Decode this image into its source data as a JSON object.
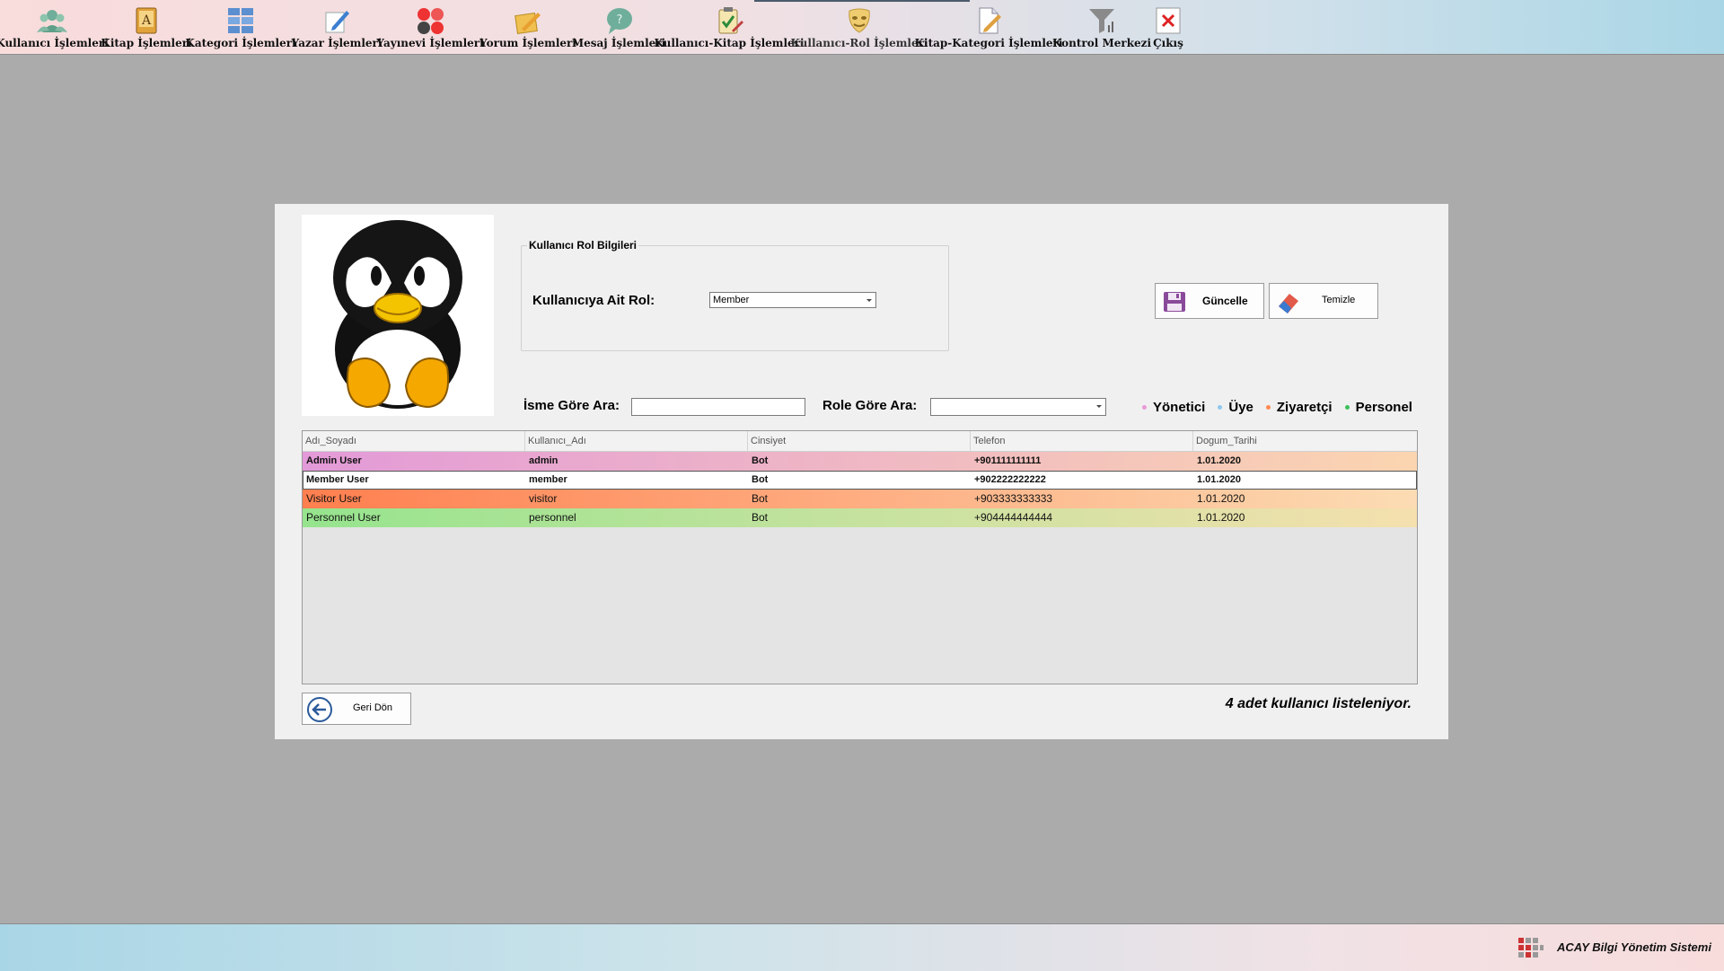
{
  "toolbar": {
    "items": [
      {
        "label": "Kullanıcı İşlemleri",
        "icon": "users-icon"
      },
      {
        "label": "Kitap İşlemleri",
        "icon": "book-icon"
      },
      {
        "label": "Kategori İşlemleri",
        "icon": "category-grid-icon"
      },
      {
        "label": "Yazar İşlemleri",
        "icon": "author-pen-icon"
      },
      {
        "label": "Yayınevi İşlemleri",
        "icon": "publisher-dots-icon"
      },
      {
        "label": "Yorum İşlemleri",
        "icon": "comment-pencil-icon"
      },
      {
        "label": "Mesaj İşlemleri",
        "icon": "message-bubble-icon"
      },
      {
        "label": "Kullanıcı-Kitap İşlemleri",
        "icon": "clipboard-check-icon"
      },
      {
        "label": "Kullanıcı-Rol İşlemleri",
        "icon": "role-mask-icon"
      },
      {
        "label": "Kitap-Kategori İşlemleri",
        "icon": "document-edit-icon"
      },
      {
        "label": "Kontrol Merkezi",
        "icon": "filter-chart-icon"
      },
      {
        "label": "Çıkış",
        "icon": "exit-close-icon"
      }
    ]
  },
  "role_group": {
    "title": "Kullanıcı Rol Bilgileri",
    "role_label": "Kullanıcıya Ait Rol:",
    "role_value": "Member"
  },
  "actions": {
    "update_label": "Güncelle",
    "clear_label": "Temizle"
  },
  "search": {
    "name_label": "İsme Göre Ara:",
    "name_value": "",
    "role_label": "Role Göre Ara:",
    "role_value": ""
  },
  "legend": [
    {
      "label": "Yönetici",
      "color": "#e89ad8"
    },
    {
      "label": "Üye",
      "color": "#8ec8ee"
    },
    {
      "label": "Ziyaretçi",
      "color": "#ff8a50"
    },
    {
      "label": "Personel",
      "color": "#3cc05a"
    }
  ],
  "grid": {
    "columns": [
      "Adı_Soyadı",
      "Kullanıcı_Adı",
      "Cinsiyet",
      "Telefon",
      "Dogum_Tarihi"
    ],
    "rows": [
      {
        "cells": [
          "Admin User",
          "admin",
          "Bot",
          "+901111111111",
          "1.01.2020"
        ],
        "bold": true,
        "selected": false,
        "start_color": "#e39ad8",
        "end_color": "#fbd5b0"
      },
      {
        "cells": [
          "Member User",
          "member",
          "Bot",
          "+902222222222",
          "1.01.2020"
        ],
        "bold": true,
        "selected": true,
        "start_color": "#ffffff",
        "end_color": "#ffffff"
      },
      {
        "cells": [
          "Visitor User",
          "visitor",
          "Bot",
          "+903333333333",
          "1.01.2020"
        ],
        "bold": false,
        "selected": false,
        "start_color": "#ff7f4f",
        "end_color": "#fcdcb4"
      },
      {
        "cells": [
          "Personnel User",
          "personnel",
          "Bot",
          "+904444444444",
          "1.01.2020"
        ],
        "bold": false,
        "selected": false,
        "start_color": "#96e48e",
        "end_color": "#f5e0ae"
      }
    ]
  },
  "back_label": "Geri Dön",
  "count_text": "4 adet kullanıcı listeleniyor.",
  "footer": {
    "text": "ACAY Bilgi Yönetim Sistemi",
    "logo_icon": "app-logo-icon"
  }
}
